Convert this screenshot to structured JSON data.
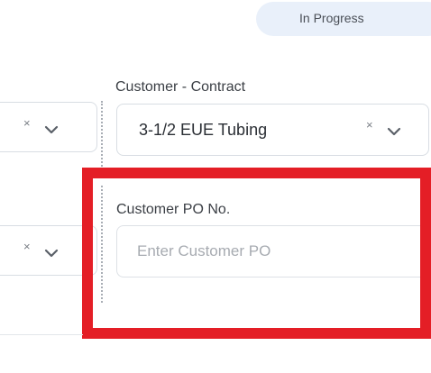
{
  "status": {
    "label": "In Progress",
    "color": "#e9f0fa"
  },
  "left_column": {
    "select_1": {
      "clear_icon": "×",
      "chevron_icon": "chevron-down-icon"
    },
    "select_2": {
      "clear_icon": "×",
      "chevron_icon": "chevron-down-icon"
    }
  },
  "contract": {
    "label": "Customer - Contract",
    "value": "3-1/2 EUE Tubing",
    "clear_icon": "×",
    "chevron_icon": "chevron-down-icon"
  },
  "customer_po": {
    "label": "Customer PO No.",
    "value": "",
    "placeholder": "Enter Customer PO"
  },
  "highlight": {
    "color": "#e41e26"
  }
}
